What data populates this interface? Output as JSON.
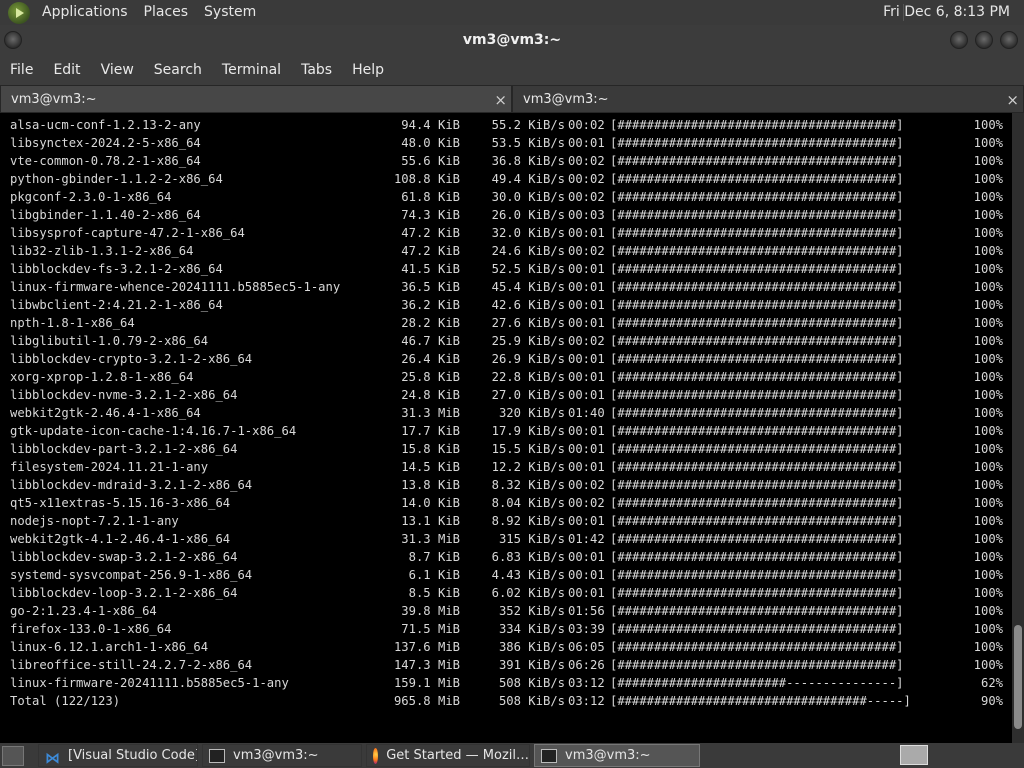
{
  "top_panel": {
    "menus": [
      "Applications",
      "Places",
      "System"
    ],
    "clock": "Fri Dec  6,  8:13 PM"
  },
  "window": {
    "title": "vm3@vm3:~"
  },
  "menubar": [
    "File",
    "Edit",
    "View",
    "Search",
    "Terminal",
    "Tabs",
    "Help"
  ],
  "tabs": [
    {
      "label": "vm3@vm3:~",
      "close": "×"
    },
    {
      "label": "vm3@vm3:~",
      "close": "×"
    }
  ],
  "terminal": {
    "rows": [
      {
        "name": "alsa-ucm-conf-1.2.13-2-any",
        "size": "94.4 KiB",
        "rate": "55.2 KiB/s",
        "time": "00:02",
        "bar": "[######################################]",
        "pct": "100%"
      },
      {
        "name": "libsynctex-2024.2-5-x86_64",
        "size": "48.0 KiB",
        "rate": "53.5 KiB/s",
        "time": "00:01",
        "bar": "[######################################]",
        "pct": "100%"
      },
      {
        "name": "vte-common-0.78.2-1-x86_64",
        "size": "55.6 KiB",
        "rate": "36.8 KiB/s",
        "time": "00:02",
        "bar": "[######################################]",
        "pct": "100%"
      },
      {
        "name": "python-gbinder-1.1.2-2-x86_64",
        "size": "108.8 KiB",
        "rate": "49.4 KiB/s",
        "time": "00:02",
        "bar": "[######################################]",
        "pct": "100%"
      },
      {
        "name": "pkgconf-2.3.0-1-x86_64",
        "size": "61.8 KiB",
        "rate": "30.0 KiB/s",
        "time": "00:02",
        "bar": "[######################################]",
        "pct": "100%"
      },
      {
        "name": "libgbinder-1.1.40-2-x86_64",
        "size": "74.3 KiB",
        "rate": "26.0 KiB/s",
        "time": "00:03",
        "bar": "[######################################]",
        "pct": "100%"
      },
      {
        "name": "libsysprof-capture-47.2-1-x86_64",
        "size": "47.2 KiB",
        "rate": "32.0 KiB/s",
        "time": "00:01",
        "bar": "[######################################]",
        "pct": "100%"
      },
      {
        "name": "lib32-zlib-1.3.1-2-x86_64",
        "size": "47.2 KiB",
        "rate": "24.6 KiB/s",
        "time": "00:02",
        "bar": "[######################################]",
        "pct": "100%"
      },
      {
        "name": "libblockdev-fs-3.2.1-2-x86_64",
        "size": "41.5 KiB",
        "rate": "52.5 KiB/s",
        "time": "00:01",
        "bar": "[######################################]",
        "pct": "100%"
      },
      {
        "name": "linux-firmware-whence-20241111.b5885ec5-1-any",
        "size": "36.5 KiB",
        "rate": "45.4 KiB/s",
        "time": "00:01",
        "bar": "[######################################]",
        "pct": "100%"
      },
      {
        "name": "libwbclient-2:4.21.2-1-x86_64",
        "size": "36.2 KiB",
        "rate": "42.6 KiB/s",
        "time": "00:01",
        "bar": "[######################################]",
        "pct": "100%"
      },
      {
        "name": "npth-1.8-1-x86_64",
        "size": "28.2 KiB",
        "rate": "27.6 KiB/s",
        "time": "00:01",
        "bar": "[######################################]",
        "pct": "100%"
      },
      {
        "name": "libglibutil-1.0.79-2-x86_64",
        "size": "46.7 KiB",
        "rate": "25.9 KiB/s",
        "time": "00:02",
        "bar": "[######################################]",
        "pct": "100%"
      },
      {
        "name": "libblockdev-crypto-3.2.1-2-x86_64",
        "size": "26.4 KiB",
        "rate": "26.9 KiB/s",
        "time": "00:01",
        "bar": "[######################################]",
        "pct": "100%"
      },
      {
        "name": "xorg-xprop-1.2.8-1-x86_64",
        "size": "25.8 KiB",
        "rate": "22.8 KiB/s",
        "time": "00:01",
        "bar": "[######################################]",
        "pct": "100%"
      },
      {
        "name": "libblockdev-nvme-3.2.1-2-x86_64",
        "size": "24.8 KiB",
        "rate": "27.0 KiB/s",
        "time": "00:01",
        "bar": "[######################################]",
        "pct": "100%"
      },
      {
        "name": "webkit2gtk-2.46.4-1-x86_64",
        "size": "31.3 MiB",
        "rate": "320 KiB/s",
        "time": "01:40",
        "bar": "[######################################]",
        "pct": "100%"
      },
      {
        "name": "gtk-update-icon-cache-1:4.16.7-1-x86_64",
        "size": "17.7 KiB",
        "rate": "17.9 KiB/s",
        "time": "00:01",
        "bar": "[######################################]",
        "pct": "100%"
      },
      {
        "name": "libblockdev-part-3.2.1-2-x86_64",
        "size": "15.8 KiB",
        "rate": "15.5 KiB/s",
        "time": "00:01",
        "bar": "[######################################]",
        "pct": "100%"
      },
      {
        "name": "filesystem-2024.11.21-1-any",
        "size": "14.5 KiB",
        "rate": "12.2 KiB/s",
        "time": "00:01",
        "bar": "[######################################]",
        "pct": "100%"
      },
      {
        "name": "libblockdev-mdraid-3.2.1-2-x86_64",
        "size": "13.8 KiB",
        "rate": "8.32 KiB/s",
        "time": "00:02",
        "bar": "[######################################]",
        "pct": "100%"
      },
      {
        "name": "qt5-x11extras-5.15.16-3-x86_64",
        "size": "14.0 KiB",
        "rate": "8.04 KiB/s",
        "time": "00:02",
        "bar": "[######################################]",
        "pct": "100%"
      },
      {
        "name": "nodejs-nopt-7.2.1-1-any",
        "size": "13.1 KiB",
        "rate": "8.92 KiB/s",
        "time": "00:01",
        "bar": "[######################################]",
        "pct": "100%"
      },
      {
        "name": "webkit2gtk-4.1-2.46.4-1-x86_64",
        "size": "31.3 MiB",
        "rate": "315 KiB/s",
        "time": "01:42",
        "bar": "[######################################]",
        "pct": "100%"
      },
      {
        "name": "libblockdev-swap-3.2.1-2-x86_64",
        "size": "8.7 KiB",
        "rate": "6.83 KiB/s",
        "time": "00:01",
        "bar": "[######################################]",
        "pct": "100%"
      },
      {
        "name": "systemd-sysvcompat-256.9-1-x86_64",
        "size": "6.1 KiB",
        "rate": "4.43 KiB/s",
        "time": "00:01",
        "bar": "[######################################]",
        "pct": "100%"
      },
      {
        "name": "libblockdev-loop-3.2.1-2-x86_64",
        "size": "8.5 KiB",
        "rate": "6.02 KiB/s",
        "time": "00:01",
        "bar": "[######################################]",
        "pct": "100%"
      },
      {
        "name": "go-2:1.23.4-1-x86_64",
        "size": "39.8 MiB",
        "rate": "352 KiB/s",
        "time": "01:56",
        "bar": "[######################################]",
        "pct": "100%"
      },
      {
        "name": "firefox-133.0-1-x86_64",
        "size": "71.5 MiB",
        "rate": "334 KiB/s",
        "time": "03:39",
        "bar": "[######################################]",
        "pct": "100%"
      },
      {
        "name": "linux-6.12.1.arch1-1-x86_64",
        "size": "137.6 MiB",
        "rate": "386 KiB/s",
        "time": "06:05",
        "bar": "[######################################]",
        "pct": "100%"
      },
      {
        "name": "libreoffice-still-24.2.7-2-x86_64",
        "size": "147.3 MiB",
        "rate": "391 KiB/s",
        "time": "06:26",
        "bar": "[######################################]",
        "pct": "100%"
      },
      {
        "name": "linux-firmware-20241111.b5885ec5-1-any",
        "size": "159.1 MiB",
        "rate": "508 KiB/s",
        "time": "03:12",
        "bar": "[#######################---------------]",
        "pct": "62%"
      },
      {
        "name": "Total (122/123)",
        "size": "965.8 MiB",
        "rate": "508 KiB/s",
        "time": "03:12",
        "bar": "[##################################-----]",
        "pct": "90%"
      }
    ]
  },
  "taskbar": {
    "items": [
      {
        "label": "[Visual Studio Code]",
        "icon": "vscode-icon"
      },
      {
        "label": "vm3@vm3:~",
        "icon": "terminal-icon"
      },
      {
        "label": "Get Started — Mozil…",
        "icon": "firefox-icon"
      },
      {
        "label": "vm3@vm3:~",
        "icon": "terminal-icon"
      }
    ]
  }
}
